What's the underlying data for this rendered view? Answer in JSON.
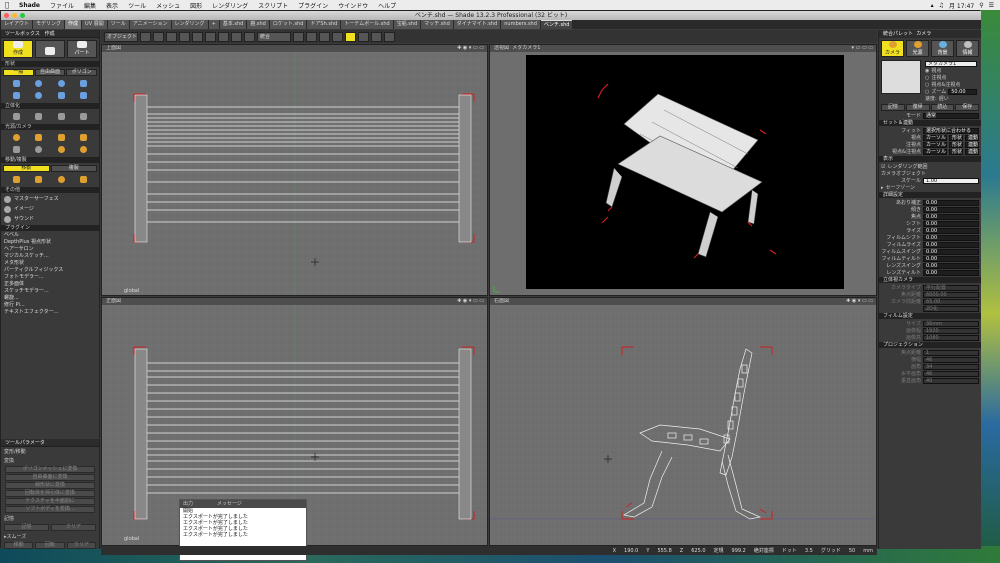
{
  "menubar": {
    "app": "Shade",
    "items": [
      "ファイル",
      "編集",
      "表示",
      "ツール",
      "メッシュ",
      "図形",
      "レンダリング",
      "スクリプト",
      "プラグイン",
      "ウインドウ",
      "ヘルプ"
    ],
    "clock": "月 17:47"
  },
  "window": {
    "title": "ベンチ.shd — Shade 13.2.3 Professional (32 ビット)"
  },
  "tabs": [
    "レイアウト",
    "モデリング",
    "作成",
    "UV 展開",
    "ツール",
    "アニメーション",
    "レンダリング",
    "+",
    "基本.shd",
    "鎧.shd",
    "ロケット.shd",
    "ドアSh.shd",
    "トーテムポール.shd",
    "宝船.shd",
    "マッチ.shd",
    "ダイナマイト.shd",
    "numbers.shd",
    "ベンチ.shd"
  ],
  "toolbox": {
    "title": "ツールボックス",
    "title2": "作成",
    "big_buttons": [
      "作成",
      "",
      "パート"
    ],
    "section_shape": "形状",
    "seg_shape": [
      "一般",
      "自由曲面",
      "ポリゴン"
    ],
    "section_solid": "立体化",
    "section_light": "光源/カメラ",
    "section_move": "移動/複製",
    "seg_move": [
      "移動",
      "複製"
    ],
    "section_other": "その他",
    "master_surface": "マスターサーフェス",
    "image": "イメージ",
    "sound": "サウンド",
    "section_plugin": "プラグイン",
    "plugins": [
      "ベベル",
      "DepthPlus 視点形状",
      "ヘアーサロン",
      "マジカルスケッチ...",
      "メタ形状",
      "パーティクルフィジックス",
      "フォトモデラー...",
      "正多面体",
      "スケッチモデラー...",
      "螺旋...",
      "修行 Pi...",
      "テキストエフェクター..."
    ]
  },
  "toolparam": {
    "title": "ツールパラメータ",
    "sub": "変形/移動",
    "label_transform": "変換",
    "buttons": [
      "ポリゴンメッシュに変換",
      "自由曲面に変換",
      "線形状に変換",
      "回転体を掃引体に変換",
      "テクスチャを半面割に",
      "ソフトボディを変換..."
    ],
    "label_memory": "記憶",
    "row1": [
      "記憶",
      "クリア"
    ],
    "smooth": "スムーズ",
    "row2": [
      "移動",
      "回転",
      "クリア"
    ]
  },
  "vtoolbar": {
    "objects": "オブジェクト",
    "merge": "統合"
  },
  "viewports": {
    "top_left": "上面図",
    "top_right_label": "透視図",
    "top_right_camera": "メタカメラ1",
    "bottom_left": "正面図",
    "bottom_right": "右面図",
    "global": "global"
  },
  "console": {
    "header": [
      "出力",
      "メッセージ"
    ],
    "lines": [
      "開始",
      "エクスポートが完了しました",
      "エクスポートが完了しました",
      "エクスポートが完了しました",
      "エクスポートが完了しました"
    ]
  },
  "statusbar": {
    "x_label": "X",
    "x": "190.0",
    "y_label": "Y",
    "y": "555.8",
    "z_label": "Z",
    "z": "625.0",
    "angle_label": "定規",
    "angle": "999.2",
    "unit": "絶対座標",
    "dot_label": "ドット",
    "dot": "3.5",
    "grid_label": "グリッド",
    "grid": "50",
    "unit2": "mm"
  },
  "rpanel": {
    "title": "統合パレット",
    "title2": "カメラ",
    "icons": [
      "カメラ",
      "光源",
      "背景",
      "情報"
    ],
    "camera_name": "メタカメラ1",
    "radio": [
      "視点",
      "注視点",
      "視点&注視点",
      "ズーム"
    ],
    "zoom": "50.00",
    "speed_label": "速度:",
    "speed": "遅い",
    "buttons1": [
      "記憶",
      "復帰",
      "読込",
      "保存"
    ],
    "mode_label": "モード",
    "mode": "通常",
    "section_set": "セット＆連動",
    "fit": "フィット",
    "fit_label": "選択形状に合わせる",
    "rows_set": [
      "視点",
      "注視点",
      "視点&注視点"
    ],
    "set_btns": [
      "カーソル",
      "形状",
      "連動"
    ],
    "section_display": "表示",
    "render_range": "レンダリング範囲",
    "camera_object": "カメラオブジェクト",
    "scale_label": "スケール",
    "scale": "1.00",
    "safe_zone": "セーフゾーン",
    "section_detail": "詳細設定",
    "detail_rows": [
      {
        "k": "あおり補正",
        "v": "0.00"
      },
      {
        "k": "傾き",
        "v": "0.00"
      },
      {
        "k": "焦点",
        "v": "0.00"
      },
      {
        "k": "シフト",
        "v": "0.00"
      },
      {
        "k": "ライズ",
        "v": "0.00"
      },
      {
        "k": "フィルムシフト",
        "v": "0.00"
      },
      {
        "k": "フィルムライズ",
        "v": "0.00"
      },
      {
        "k": "フィルムスイング",
        "v": "0.00"
      },
      {
        "k": "フィルムティルト",
        "v": "0.00"
      },
      {
        "k": "レンズスイング",
        "v": "0.00"
      },
      {
        "k": "レンズティルト",
        "v": "0.00"
      }
    ],
    "section_sensor": "立体視カメラ",
    "sensor_rows": [
      {
        "k": "カメラタイプ",
        "v": "平行配置"
      },
      {
        "k": "焦点距離",
        "v": "6000.00"
      },
      {
        "k": "カメラ間距離",
        "v": "65.00"
      },
      {
        "k": "",
        "v": "2D化"
      }
    ],
    "section_film": "フィルム設定",
    "film_rows": [
      {
        "k": "サイズ",
        "v": "36mm"
      },
      {
        "k": "画像幅",
        "v": "1920"
      },
      {
        "k": "画像高",
        "v": "1080"
      }
    ],
    "section_projection": "プロジェクション",
    "proj_rows": [
      {
        "k": "焦点距離",
        "v": "1"
      },
      {
        "k": "横幅",
        "v": "46"
      },
      {
        "k": "画角",
        "v": "34"
      },
      {
        "k": "水平画角",
        "v": "46"
      },
      {
        "k": "垂直画角",
        "v": "40"
      }
    ]
  },
  "colors": {
    "accent_yellow": "#f0e020",
    "viewport_bg": "#6e6e6e",
    "persp_bg": "#000000",
    "red_marker": "#d02020"
  }
}
